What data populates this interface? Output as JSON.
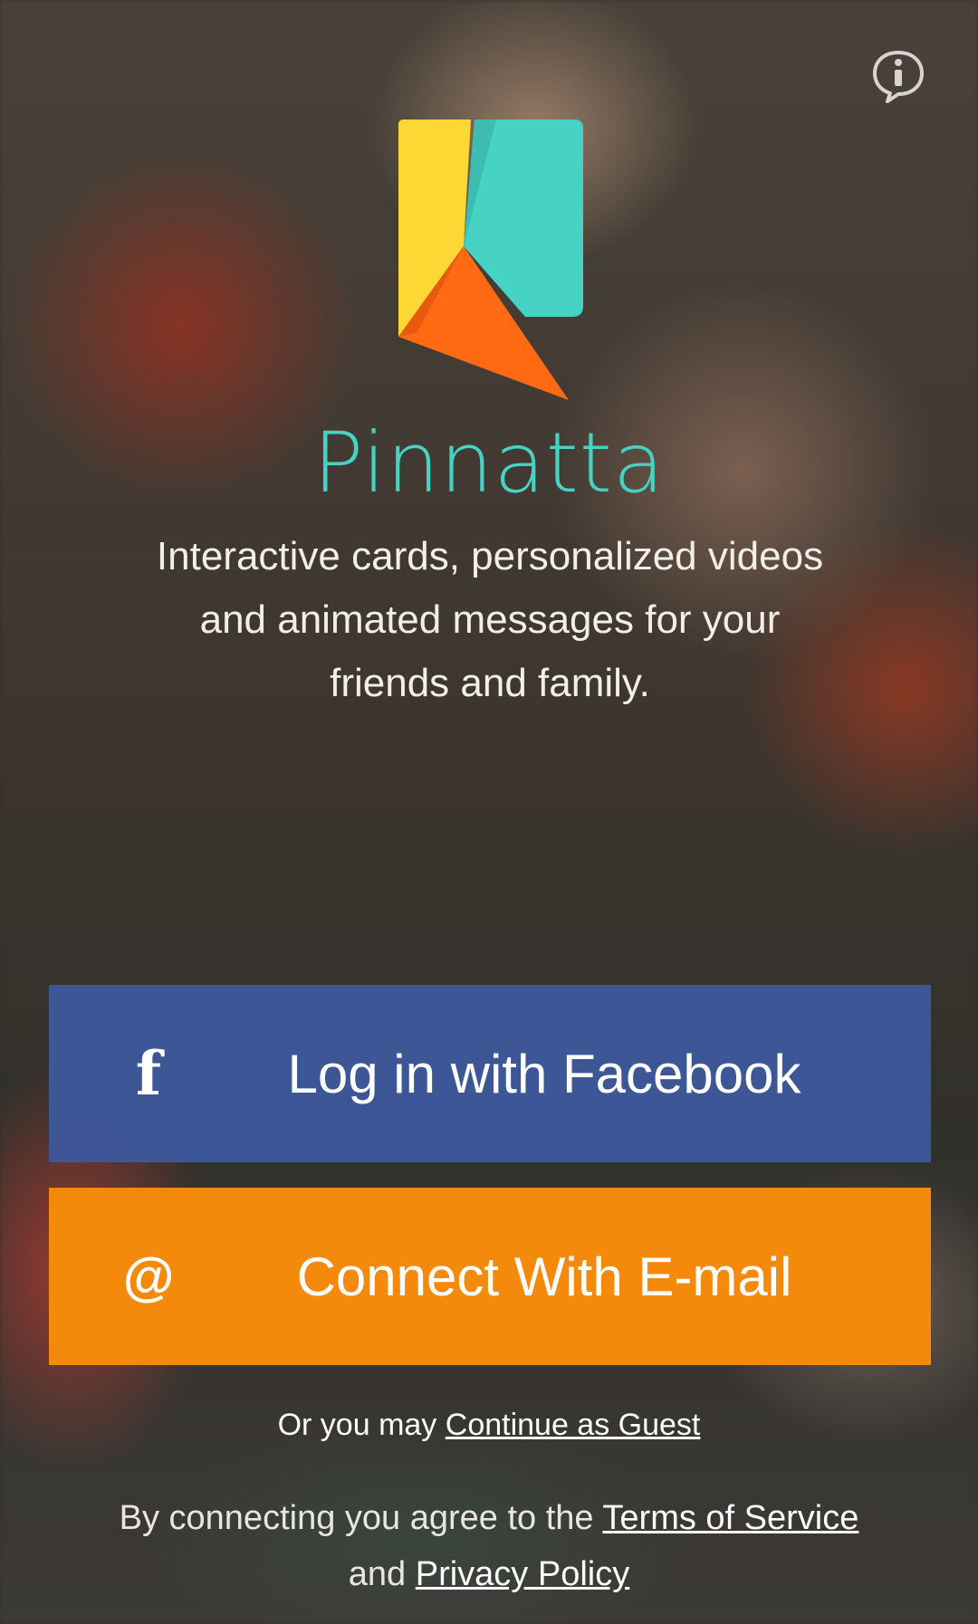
{
  "app": {
    "title": "Pinnatta",
    "tagline": "Interactive cards, personalized videos and animated messages for your friends and family."
  },
  "icons": {
    "info": "info-icon",
    "logo": "pinnatta-logo",
    "facebook": "facebook-icon",
    "email": "at-sign-icon"
  },
  "buttons": {
    "facebook": {
      "icon_glyph": "f",
      "label": "Log in with Facebook"
    },
    "email": {
      "icon_glyph": "@",
      "label": "Connect With E-mail"
    }
  },
  "guest": {
    "prefix": "Or you may ",
    "link": "Continue as Guest"
  },
  "legal": {
    "prefix": "By connecting you agree to the ",
    "terms_link": "Terms of Service",
    "middle": " and ",
    "privacy_link": "Privacy Policy"
  },
  "colors": {
    "title": "#46d3c3",
    "facebook_button": "#3d59a0",
    "email_button": "#f48a0c",
    "logo_yellow": "#fdd835",
    "logo_teal": "#46d3c3",
    "logo_orange": "#ff6a13"
  }
}
